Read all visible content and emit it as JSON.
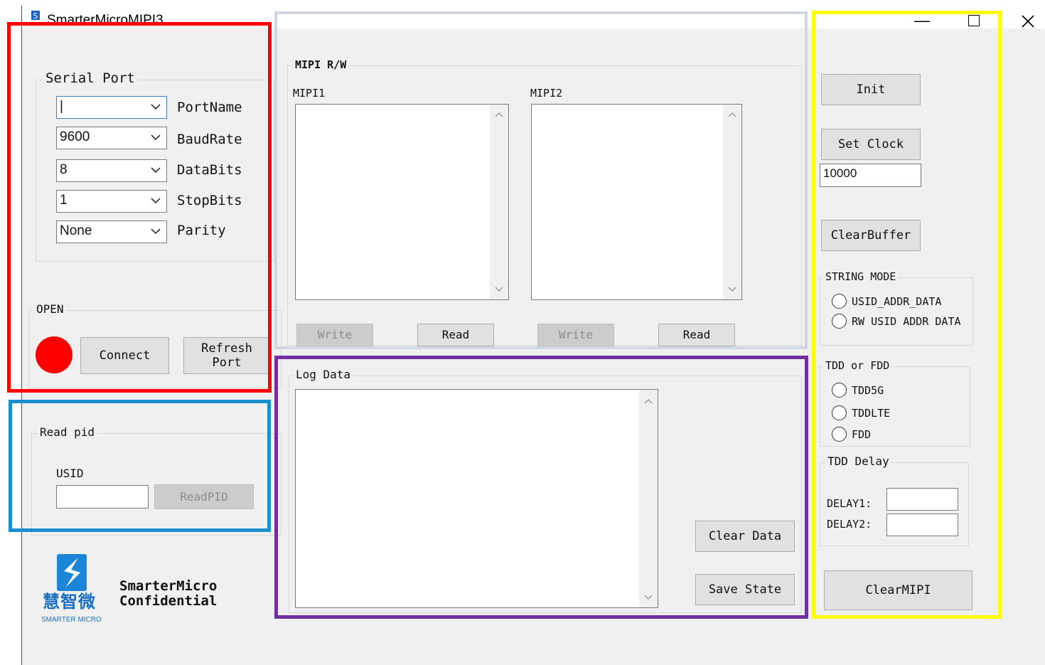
{
  "window": {
    "title": "SmarterMicroMIPI3"
  },
  "serial_port": {
    "group_label": "Serial Port",
    "fields": [
      {
        "value": "|",
        "label": "PortName"
      },
      {
        "value": "9600",
        "label": "BaudRate"
      },
      {
        "value": "8",
        "label": "DataBits"
      },
      {
        "value": "1",
        "label": "StopBits"
      },
      {
        "value": "None",
        "label": "Parity"
      }
    ]
  },
  "open": {
    "group_label": "OPEN",
    "status_color": "#ff0000",
    "connect_label": "Connect",
    "refresh_label": "Refresh\nPort"
  },
  "read_pid": {
    "group_label": "Read pid",
    "usid_label": "USID",
    "usid_value": "",
    "button_label": "ReadPID"
  },
  "logo": {
    "chinese": "慧智微",
    "english": "SMARTER MICRO",
    "line1": "SmarterMicro",
    "line2": "Confidential"
  },
  "mipi_rw": {
    "group_label": "MIPI R/W",
    "mipi1_label": "MIPI1",
    "mipi2_label": "MIPI2",
    "write_label": "Write",
    "read_label": "Read"
  },
  "log": {
    "group_label": "Log Data",
    "clear_label": "Clear Data",
    "save_label": "Save State"
  },
  "controls": {
    "init_label": "Init",
    "set_clock_label": "Set Clock",
    "clock_value": "10000",
    "clear_buffer_label": "ClearBuffer",
    "string_mode_label": "STRING MODE",
    "string_modes": [
      "USID_ADDR_DATA",
      "RW USID ADDR DATA"
    ],
    "tdd_fdd_label": "TDD or FDD",
    "tdd_options": [
      "TDD5G",
      "TDDLTE",
      "FDD"
    ],
    "tdd_delay_label": "TDD Delay",
    "delay1_label": "DELAY1:",
    "delay2_label": "DELAY2:",
    "delay1_value": "",
    "delay2_value": "",
    "clear_mipi_label": "ClearMIPI"
  },
  "highlight_colors": {
    "serial": "#ff0000",
    "read_pid": "#1a8fd0",
    "mipi": "#d0d6e2",
    "log": "#7030a0",
    "controls": "#ffff00"
  }
}
